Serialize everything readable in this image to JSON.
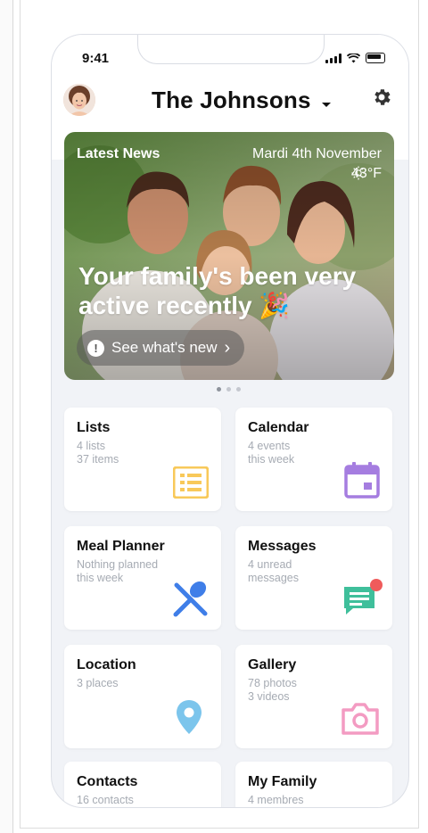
{
  "status": {
    "time": "9:41"
  },
  "header": {
    "title": "The Johnsons"
  },
  "hero": {
    "section_label": "Latest News",
    "date": "Mardi 4th November",
    "weather": "43°F",
    "headline": "Your family's been very active recently 🎉",
    "cta": "See what's new"
  },
  "carousel": {
    "pages": 3,
    "active": 0
  },
  "cards": [
    {
      "title": "Lists",
      "line1": "4 lists",
      "line2": "37 items",
      "icon": "list-icon",
      "color": "#f8c95a"
    },
    {
      "title": "Calendar",
      "line1": "4 events",
      "line2": "this week",
      "icon": "calendar-icon",
      "color": "#a57de0"
    },
    {
      "title": "Meal Planner",
      "line1": "Nothing planned",
      "line2": "this week",
      "icon": "utensils-icon",
      "color": "#3f7ee8"
    },
    {
      "title": "Messages",
      "line1": "4 unread",
      "line2": "messages",
      "icon": "chat-icon",
      "color": "#3fbf9b"
    },
    {
      "title": "Location",
      "line1": "3 places",
      "line2": "",
      "icon": "map-pin-icon",
      "color": "#7cc5ec"
    },
    {
      "title": "Gallery",
      "line1": "78 photos",
      "line2": "3 videos",
      "icon": "camera-icon",
      "color": "#f39bc2"
    },
    {
      "title": "Contacts",
      "line1": "16 contacts",
      "line2": "",
      "icon": "contacts-icon",
      "color": "#111111"
    },
    {
      "title": "My Family",
      "line1": "4 membres",
      "line2": "",
      "icon": "family-icon",
      "color": "#111111"
    }
  ],
  "colors": {
    "badge": "#ef5b5b",
    "background": "#f1f3f7"
  }
}
